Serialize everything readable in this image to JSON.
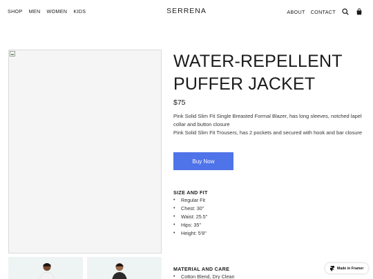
{
  "nav": {
    "left_links": [
      "SHOP",
      "MEN",
      "WOMEN",
      "KIDS"
    ],
    "brand": "SERRENA",
    "right_links": [
      "ABOUT",
      "CONTACT"
    ],
    "icons": [
      "search-icon",
      "shopping-bag-icon"
    ]
  },
  "product": {
    "title": "WATER-REPELLENT PUFFER JACKET",
    "price": "$75",
    "description": [
      "Pink Solid Slim Fit Single Breasted Formal Blazer, has long sleeves, notched lapel collar and button closure",
      "Pink Solid Slim Fit Trousers, has 2 pockets and secured with hook and bar closure"
    ],
    "buy_label": "Buy Now",
    "size_fit": {
      "title": "SIZE AND FIT",
      "items": [
        "Regular Fit",
        "Chest: 30''",
        "Waist: 25.5''",
        "Hips: 35''",
        "Height: 5'8''"
      ]
    },
    "material_care": {
      "title": "MATERIAL AND CARE",
      "items": [
        "Cotton Blend, Dry Clean"
      ]
    }
  },
  "badge": {
    "label": "Made in Framer"
  },
  "colors": {
    "accent": "#4f73e8",
    "text": "#1a1a1a",
    "thumb_bg": "#eef4f3"
  }
}
